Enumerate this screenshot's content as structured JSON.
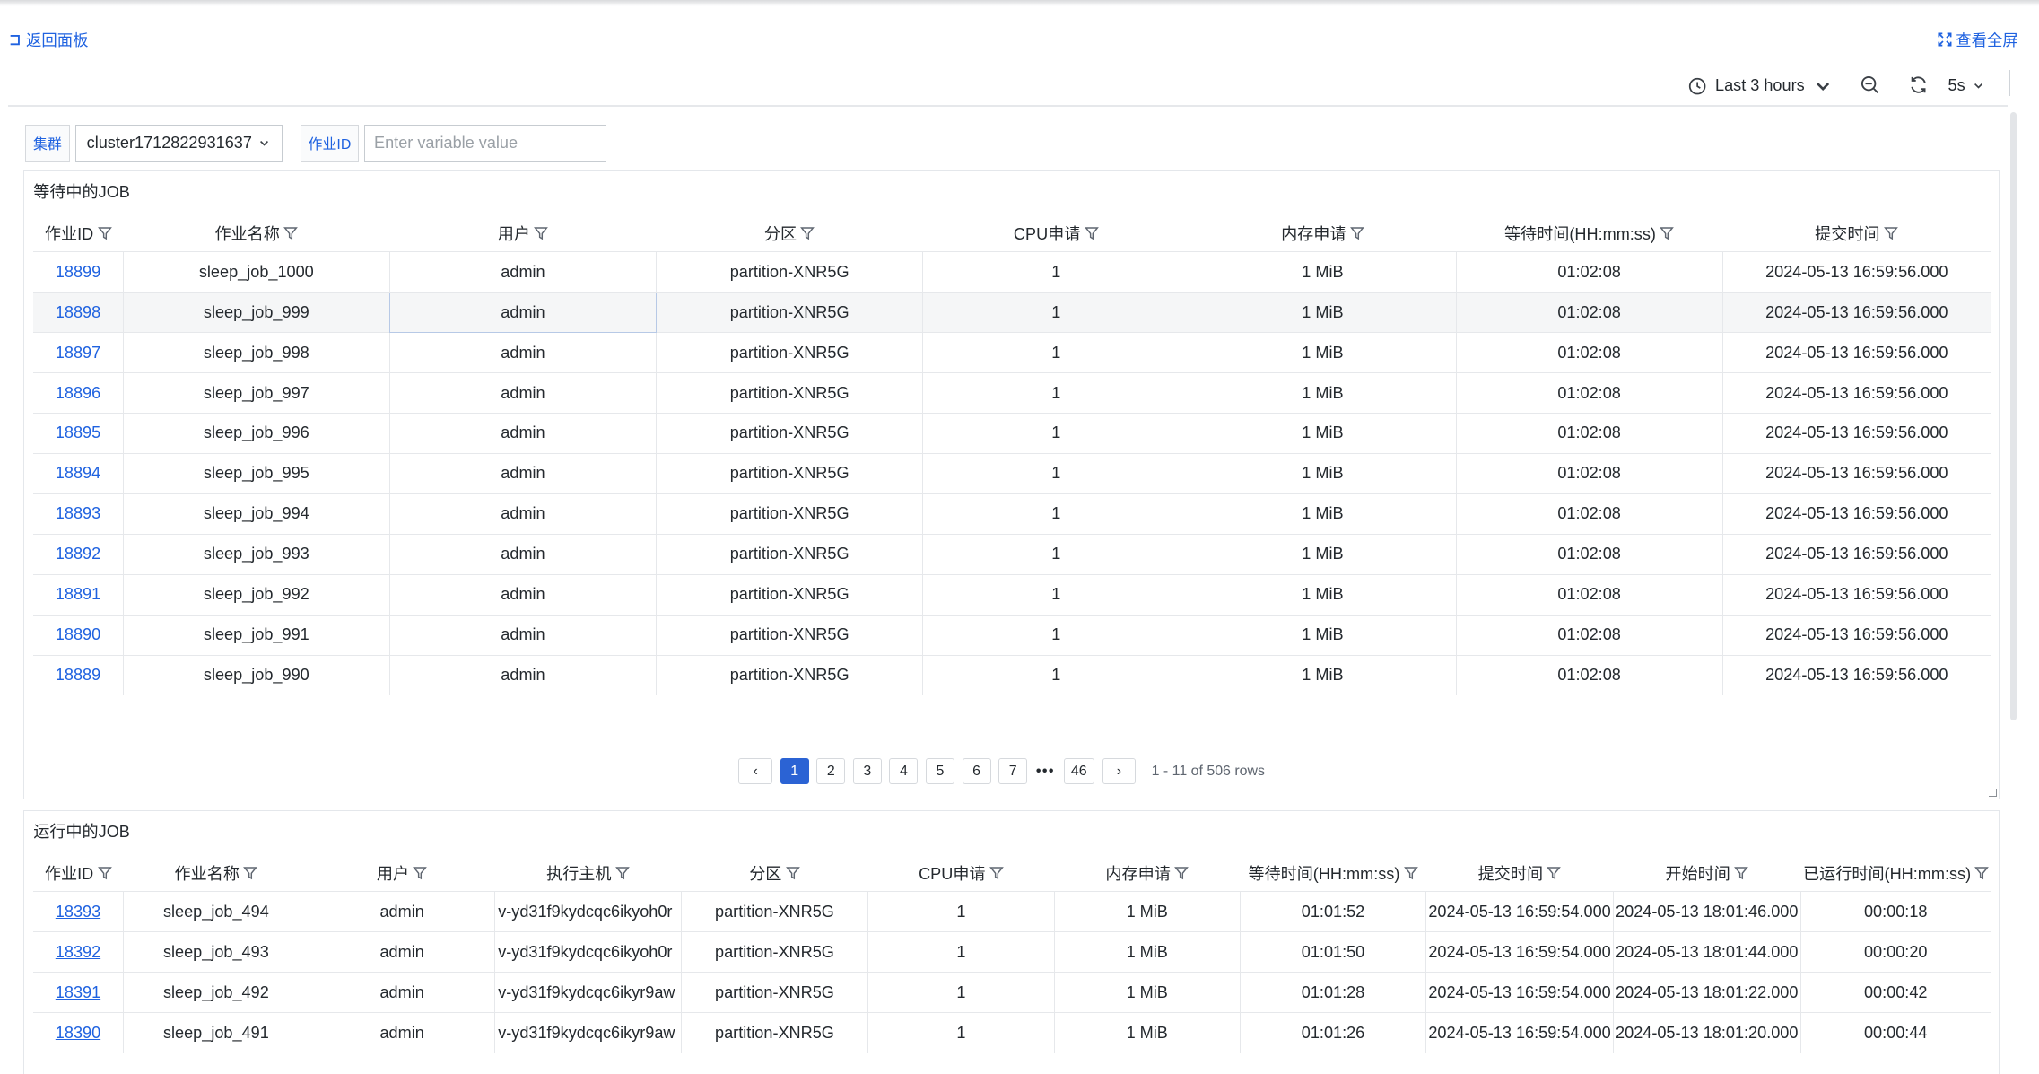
{
  "header": {
    "back_label": "返回面板",
    "fullscreen_label": "查看全屏"
  },
  "toolbar": {
    "time_range": "Last 3 hours",
    "refresh_interval": "5s"
  },
  "variables": {
    "cluster_label": "集群",
    "cluster_value": "cluster1712822931637",
    "jobid_label": "作业ID",
    "jobid_placeholder": "Enter variable value"
  },
  "pending_panel": {
    "title": "等待中的JOB",
    "columns": [
      "作业ID",
      "作业名称",
      "用户",
      "分区",
      "CPU申请",
      "内存申请",
      "等待时间(HH:mm:ss)",
      "提交时间"
    ],
    "rows": [
      [
        "18899",
        "sleep_job_1000",
        "admin",
        "partition-XNR5G",
        "1",
        "1 MiB",
        "01:02:08",
        "2024-05-13 16:59:56.000"
      ],
      [
        "18898",
        "sleep_job_999",
        "admin",
        "partition-XNR5G",
        "1",
        "1 MiB",
        "01:02:08",
        "2024-05-13 16:59:56.000"
      ],
      [
        "18897",
        "sleep_job_998",
        "admin",
        "partition-XNR5G",
        "1",
        "1 MiB",
        "01:02:08",
        "2024-05-13 16:59:56.000"
      ],
      [
        "18896",
        "sleep_job_997",
        "admin",
        "partition-XNR5G",
        "1",
        "1 MiB",
        "01:02:08",
        "2024-05-13 16:59:56.000"
      ],
      [
        "18895",
        "sleep_job_996",
        "admin",
        "partition-XNR5G",
        "1",
        "1 MiB",
        "01:02:08",
        "2024-05-13 16:59:56.000"
      ],
      [
        "18894",
        "sleep_job_995",
        "admin",
        "partition-XNR5G",
        "1",
        "1 MiB",
        "01:02:08",
        "2024-05-13 16:59:56.000"
      ],
      [
        "18893",
        "sleep_job_994",
        "admin",
        "partition-XNR5G",
        "1",
        "1 MiB",
        "01:02:08",
        "2024-05-13 16:59:56.000"
      ],
      [
        "18892",
        "sleep_job_993",
        "admin",
        "partition-XNR5G",
        "1",
        "1 MiB",
        "01:02:08",
        "2024-05-13 16:59:56.000"
      ],
      [
        "18891",
        "sleep_job_992",
        "admin",
        "partition-XNR5G",
        "1",
        "1 MiB",
        "01:02:08",
        "2024-05-13 16:59:56.000"
      ],
      [
        "18890",
        "sleep_job_991",
        "admin",
        "partition-XNR5G",
        "1",
        "1 MiB",
        "01:02:08",
        "2024-05-13 16:59:56.000"
      ],
      [
        "18889",
        "sleep_job_990",
        "admin",
        "partition-XNR5G",
        "1",
        "1 MiB",
        "01:02:08",
        "2024-05-13 16:59:56.000"
      ]
    ],
    "pagination": {
      "prev": "‹",
      "pages": [
        "1",
        "2",
        "3",
        "4",
        "5",
        "6",
        "7"
      ],
      "ellipsis": "•••",
      "last_page": "46",
      "next": "›",
      "info": "1 - 11 of 506 rows"
    }
  },
  "running_panel": {
    "title": "运行中的JOB",
    "columns": [
      "作业ID",
      "作业名称",
      "用户",
      "执行主机",
      "分区",
      "CPU申请",
      "内存申请",
      "等待时间(HH:mm:ss)",
      "提交时间",
      "开始时间",
      "已运行时间(HH:mm:ss)"
    ],
    "rows": [
      [
        "18393",
        "sleep_job_494",
        "admin",
        "v-yd31f9kydcqc6ikyoh0r",
        "partition-XNR5G",
        "1",
        "1 MiB",
        "01:01:52",
        "2024-05-13 16:59:54.000",
        "2024-05-13 18:01:46.000",
        "00:00:18"
      ],
      [
        "18392",
        "sleep_job_493",
        "admin",
        "v-yd31f9kydcqc6ikyoh0r",
        "partition-XNR5G",
        "1",
        "1 MiB",
        "01:01:50",
        "2024-05-13 16:59:54.000",
        "2024-05-13 18:01:44.000",
        "00:00:20"
      ],
      [
        "18391",
        "sleep_job_492",
        "admin",
        "v-yd31f9kydcqc6ikyr9aw",
        "partition-XNR5G",
        "1",
        "1 MiB",
        "01:01:28",
        "2024-05-13 16:59:54.000",
        "2024-05-13 18:01:22.000",
        "00:00:42"
      ],
      [
        "18390",
        "sleep_job_491",
        "admin",
        "v-yd31f9kydcqc6ikyr9aw",
        "partition-XNR5G",
        "1",
        "1 MiB",
        "01:01:26",
        "2024-05-13 16:59:54.000",
        "2024-05-13 18:01:20.000",
        "00:00:44"
      ]
    ]
  },
  "colors": {
    "link": "#1f62e0",
    "active_page": "#2b63d4",
    "border": "#e6e8eb"
  }
}
